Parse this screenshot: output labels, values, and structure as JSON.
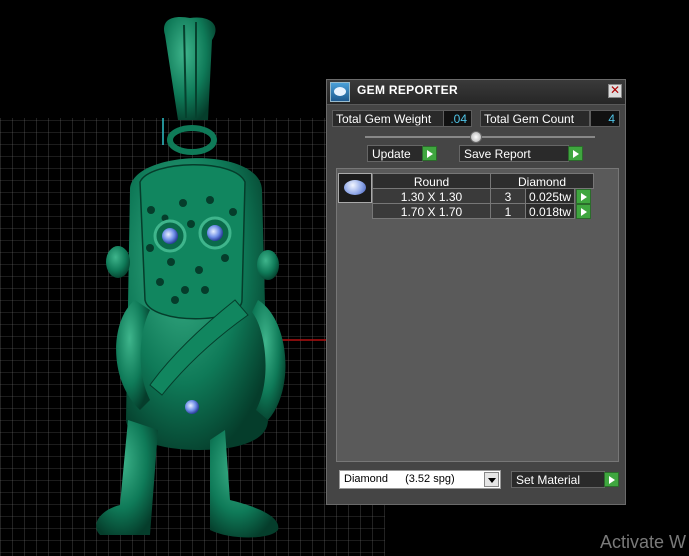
{
  "gem_reporter": {
    "title": "GEM REPORTER",
    "close_glyph": "✕",
    "total_weight_label": "Total Gem Weight",
    "total_weight_value": ".04",
    "total_count_label": "Total Gem Count",
    "total_count_value": "4",
    "update_label": "Update",
    "save_report_label": "Save Report",
    "table_headers": {
      "shape": "Round",
      "material": "Diamond"
    },
    "rows": [
      {
        "size": "1.30 X 1.30",
        "qty": "3",
        "weight": "0.025tw"
      },
      {
        "size": "1.70 X 1.70",
        "qty": "1",
        "weight": "0.018tw"
      }
    ],
    "material_select": {
      "value": "Diamond",
      "spg": "(3.52 spg)"
    },
    "set_material_label": "Set Material"
  },
  "icons": {
    "app": "gem-reporter-app-icon",
    "close": "close-icon",
    "arrow": "play-arrow-icon",
    "gem": "round-gem-icon",
    "dropdown": "chevron-down-icon"
  },
  "colors": {
    "model": "#0f7a58",
    "value_text": "#4fc3e6",
    "arrow_button": "#3fa63f",
    "gem_stone": "#8fa7e8",
    "grid_line": "#7a7a7a",
    "axis_red": "#b01010"
  },
  "watermark": "Activate W"
}
